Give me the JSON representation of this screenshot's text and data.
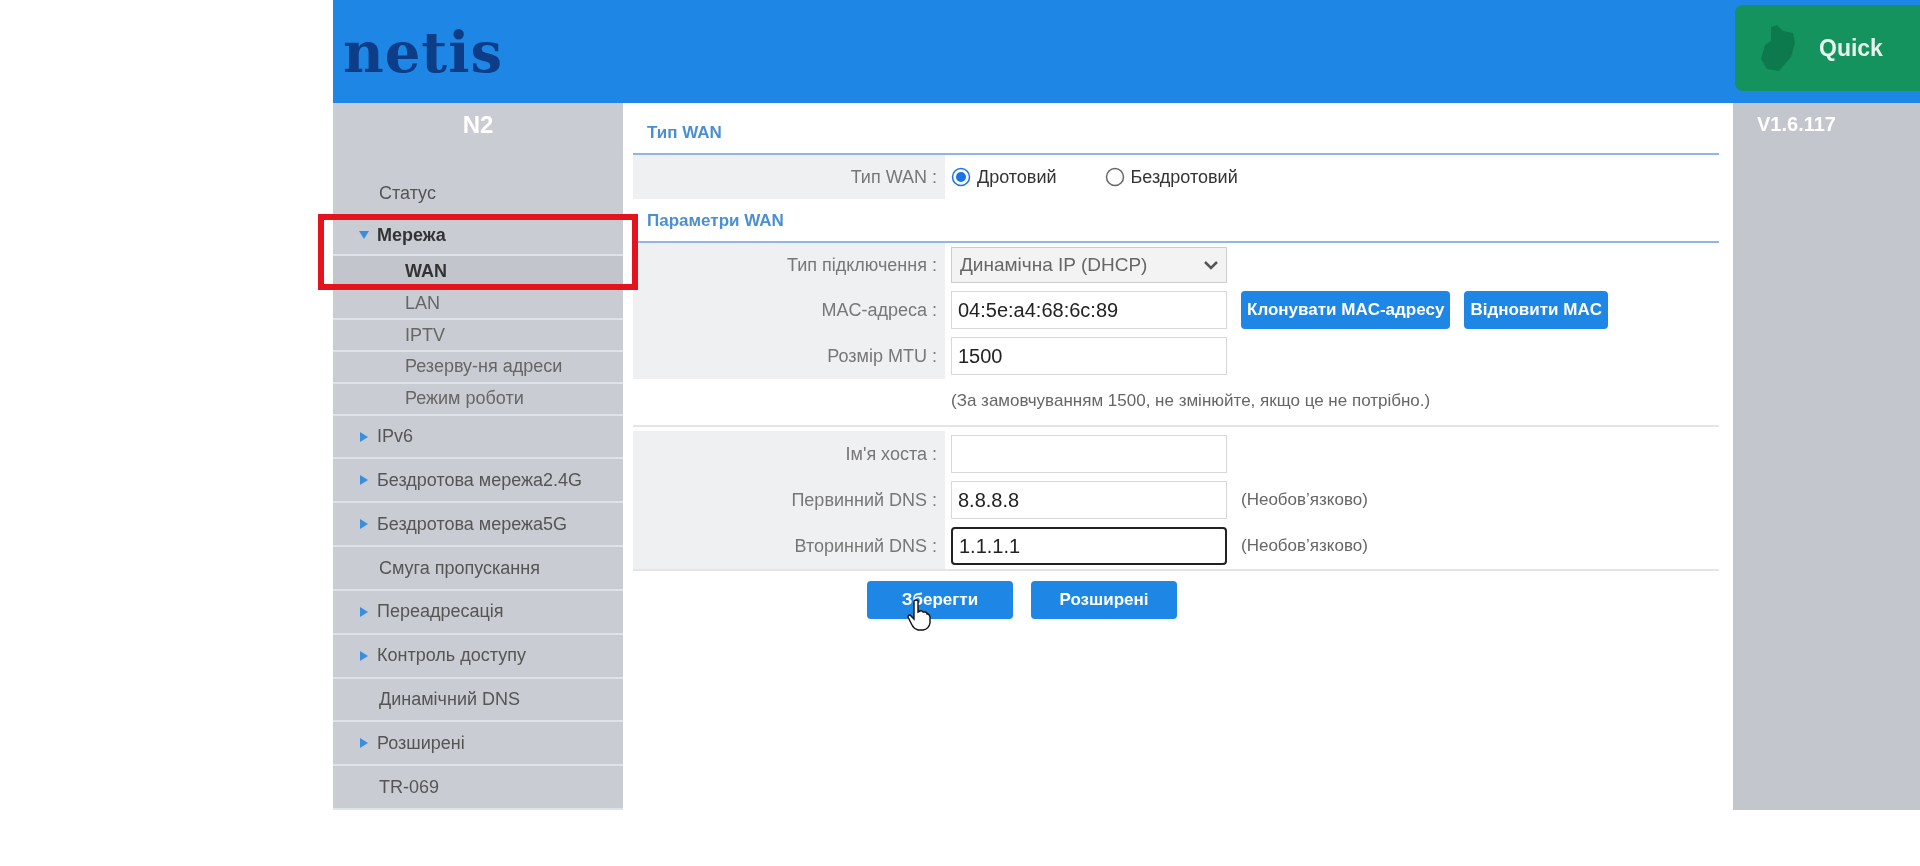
{
  "header": {
    "logo": "netis",
    "quick_button": "Quick"
  },
  "annotation": {
    "highlight_box": true
  },
  "sidebar": {
    "title": "N2",
    "items": [
      {
        "label": "Статус",
        "kind": "plain"
      },
      {
        "label": "Мережа",
        "kind": "group",
        "expanded": true,
        "children": [
          {
            "label": "WAN",
            "selected": true
          },
          {
            "label": "LAN",
            "selected": false
          },
          {
            "label": "IPTV",
            "selected": false
          },
          {
            "label": "Резерву-ня адреси",
            "selected": false
          },
          {
            "label": "Режим роботи",
            "selected": false
          }
        ]
      },
      {
        "label": "IPv6",
        "kind": "group",
        "expanded": false
      },
      {
        "label": "Бездротова мережа2.4G",
        "kind": "group",
        "expanded": false
      },
      {
        "label": "Бездротова мережа5G",
        "kind": "group",
        "expanded": false
      },
      {
        "label": "Смуга пропускання",
        "kind": "plain"
      },
      {
        "label": "Переадресація",
        "kind": "group",
        "expanded": false
      },
      {
        "label": "Контроль доступу",
        "kind": "group",
        "expanded": false
      },
      {
        "label": "Динамічний DNS",
        "kind": "plain"
      },
      {
        "label": "Розширені",
        "kind": "group",
        "expanded": false
      },
      {
        "label": "TR-069",
        "kind": "plain"
      }
    ]
  },
  "sections": [
    {
      "title": "Тип WAN",
      "rows": [
        {
          "kind": "radio",
          "label": "Тип WAN :",
          "options": [
            {
              "label": "Дротовий",
              "selected": true
            },
            {
              "label": "Бездротовий",
              "selected": false
            }
          ]
        }
      ]
    },
    {
      "title": "Параметри WAN",
      "rows": [
        {
          "kind": "select",
          "label": "Тип підключення :",
          "value": "Динамічна IP (DHCP)"
        },
        {
          "kind": "input",
          "label": "MAC-адреса :",
          "value": "04:5e:a4:68:6c:89",
          "focused": false,
          "buttons": [
            "Клонувати MAC-адресу",
            "Відновити MAC"
          ]
        },
        {
          "kind": "input",
          "label": "Розмір MTU :",
          "value": "1500",
          "focused": false
        },
        {
          "kind": "note",
          "text": "(За замовчуванням 1500, не змінюйте, якщо це не потрібно.)"
        },
        {
          "kind": "divider"
        },
        {
          "kind": "input",
          "label": "Ім'я хоста :",
          "focused": false
        },
        {
          "kind": "input",
          "label": "Первинний DNS :",
          "value": "8.8.8.8",
          "focused": false,
          "hint": "(Необов’язково)"
        },
        {
          "kind": "input",
          "label": "Вторинний DNS :",
          "value": "1.1.1.1",
          "focused": true,
          "hint": "(Необов’язково)"
        }
      ]
    }
  ],
  "buttons": [
    {
      "label": "Зберегти",
      "hovered": true
    },
    {
      "label": "Розширені",
      "hovered": false
    }
  ],
  "version": "V1.6.117"
}
